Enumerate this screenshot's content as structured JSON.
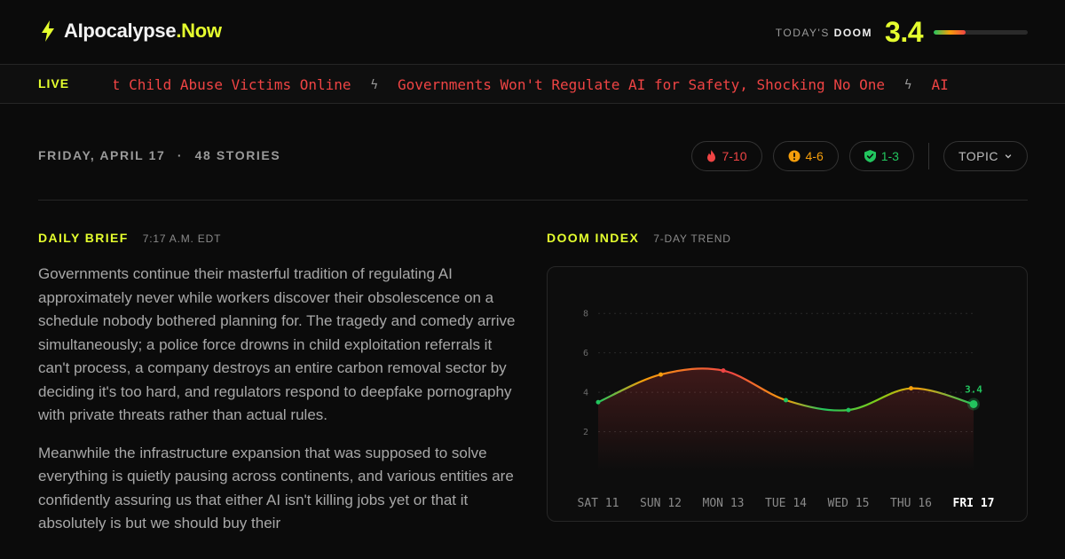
{
  "header": {
    "logo_main": "AIpocalypse",
    "logo_accent": ".Now",
    "doom_label_prefix": "TODAY'S",
    "doom_label_bold": "DOOM",
    "doom_score": "3.4",
    "doom_level_fraction": 0.34
  },
  "ticker": {
    "live_label": "LIVE",
    "items": [
      "Protect Child Abuse Victims Online",
      "Governments Won't Regulate AI for Safety, Shocking No One",
      "AI"
    ]
  },
  "dateline": {
    "date": "FRIDAY, APRIL 17",
    "separator": "·",
    "stories": "48 STORIES"
  },
  "filters": {
    "high": "7-10",
    "medium": "4-6",
    "low": "1-3",
    "topic": "TOPIC"
  },
  "brief": {
    "title": "DAILY BRIEF",
    "time": "7:17 A.M. EDT",
    "paragraphs": [
      "Governments continue their masterful tradition of regulating AI approximately never while workers discover their obsolescence on a schedule nobody bothered planning for. The tragedy and comedy arrive simultaneously; a police force drowns in child exploitation referrals it can't process, a company destroys an entire carbon removal sector by deciding it's too hard, and regulators respond to deepfake pornography with private threats rather than actual rules.",
      "Meanwhile the infrastructure expansion that was supposed to solve everything is quietly pausing across continents, and various entities are confidently assuring us that either AI isn't killing jobs yet or that it absolutely is but we should buy their"
    ]
  },
  "doom_index": {
    "title": "DOOM INDEX",
    "subtitle": "7-DAY TREND"
  },
  "colors": {
    "accent": "#e5ff2e",
    "red": "#ef4444",
    "amber": "#f59e0b",
    "green": "#22c55e"
  },
  "chart_data": {
    "type": "line",
    "categories": [
      "SAT 11",
      "SUN 12",
      "MON 13",
      "TUE 14",
      "WED 15",
      "THU 16",
      "FRI 17"
    ],
    "values": [
      3.5,
      4.9,
      5.1,
      3.6,
      3.1,
      4.2,
      3.4
    ],
    "current_label": "3.4",
    "yticks": [
      2,
      4,
      6,
      8
    ],
    "ylim": [
      0,
      9
    ],
    "grid": true,
    "highlight_category": "FRI 17"
  }
}
